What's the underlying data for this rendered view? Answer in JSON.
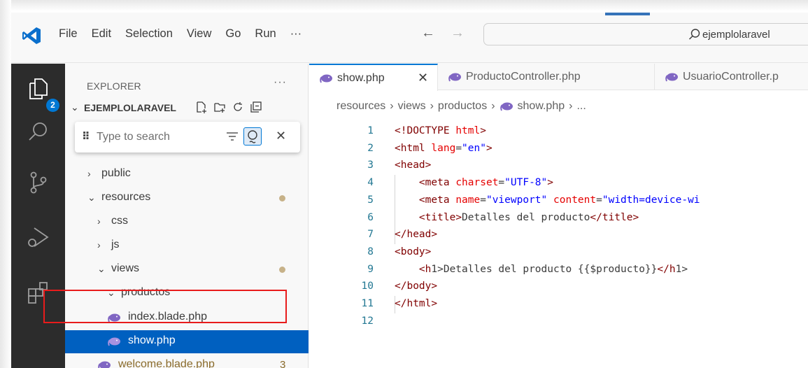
{
  "menu": [
    "File",
    "Edit",
    "Selection",
    "View",
    "Go",
    "Run",
    "···"
  ],
  "command_center": {
    "text": "ejemplolaravel"
  },
  "activity": {
    "explorer_badge": "2"
  },
  "explorer": {
    "title": "EXPLORER",
    "more": "···",
    "project": "EJEMPLOLARAVEL",
    "search_placeholder": "Type to search",
    "tree": [
      {
        "label": "public",
        "chevron": "›",
        "indent": 1
      },
      {
        "label": "resources",
        "chevron": "⌄",
        "indent": 1,
        "modified_dot": true
      },
      {
        "label": "css",
        "chevron": "›",
        "indent": 2
      },
      {
        "label": "js",
        "chevron": "›",
        "indent": 2
      },
      {
        "label": "views",
        "chevron": "⌄",
        "indent": 2,
        "modified_dot": true
      },
      {
        "label": "productos",
        "chevron": "⌄",
        "indent": 3
      },
      {
        "label": "index.blade.php",
        "indent": 4,
        "icon": "php-elephant-icon"
      },
      {
        "label": "show.php",
        "indent": 4,
        "icon": "php-elephant-icon",
        "selected": true
      },
      {
        "label": "welcome.blade.php",
        "indent": 3,
        "icon": "php-elephant-icon",
        "problems": "3"
      }
    ]
  },
  "tabs": [
    {
      "label": "show.php",
      "active": true,
      "close": "✕"
    },
    {
      "label": "ProductoController.php"
    },
    {
      "label": "UsuarioController.p"
    }
  ],
  "breadcrumb": {
    "parts": [
      "resources",
      "views",
      "productos"
    ],
    "file": "show.php",
    "tail": "..."
  },
  "code": {
    "line_numbers": [
      "1",
      "2",
      "3",
      "4",
      "5",
      "6",
      "7",
      "8",
      "9",
      "10",
      "11",
      "12"
    ],
    "lines": [
      "<!DOCTYPE html>",
      "<html lang=\"en\">",
      "<head>",
      "    <meta charset=\"UTF-8\">",
      "    <meta name=\"viewport\" content=\"width=device-wi",
      "    <title>Detalles del producto</title>",
      "</head>",
      "<body>",
      "    <h1>Detalles del producto {{$producto}}</h1>",
      "</body>",
      "</html>",
      ""
    ]
  },
  "colors": {
    "accent": "#0078d4",
    "selection": "#0060c0",
    "highlight_box": "#e81c1c",
    "activity_bar": "#2c2c2c"
  }
}
